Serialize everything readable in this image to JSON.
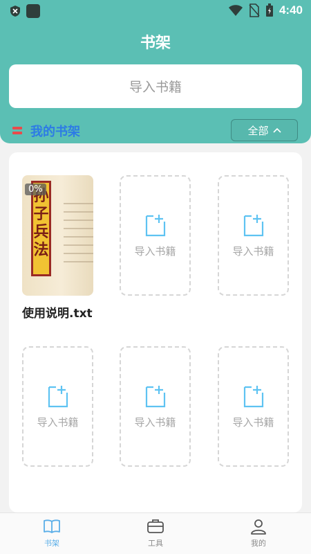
{
  "status_bar": {
    "time": "4:40"
  },
  "header": {
    "title": "书架",
    "import_placeholder": "导入书籍"
  },
  "shelf": {
    "label": "我的书架",
    "filter_label": "全部"
  },
  "books": [
    {
      "title": "使用说明.txt",
      "progress": "0%",
      "cover_text": [
        "孙",
        "子",
        "兵",
        "法"
      ]
    }
  ],
  "empty_slots": [
    {
      "label": "导入书籍"
    },
    {
      "label": "导入书籍"
    },
    {
      "label": "导入书籍"
    },
    {
      "label": "导入书籍"
    },
    {
      "label": "导入书籍"
    }
  ],
  "tabs": [
    {
      "label": "书架",
      "active": true,
      "icon": "book-icon"
    },
    {
      "label": "工具",
      "active": false,
      "icon": "toolbox-icon"
    },
    {
      "label": "我的",
      "active": false,
      "icon": "user-icon"
    }
  ],
  "colors": {
    "header_bg": "#5bbfb4",
    "accent_blue": "#2d7be5",
    "tab_active": "#5aaee8",
    "shelf_marker": "#e94b4b",
    "cover_banner": "#f1c233"
  }
}
